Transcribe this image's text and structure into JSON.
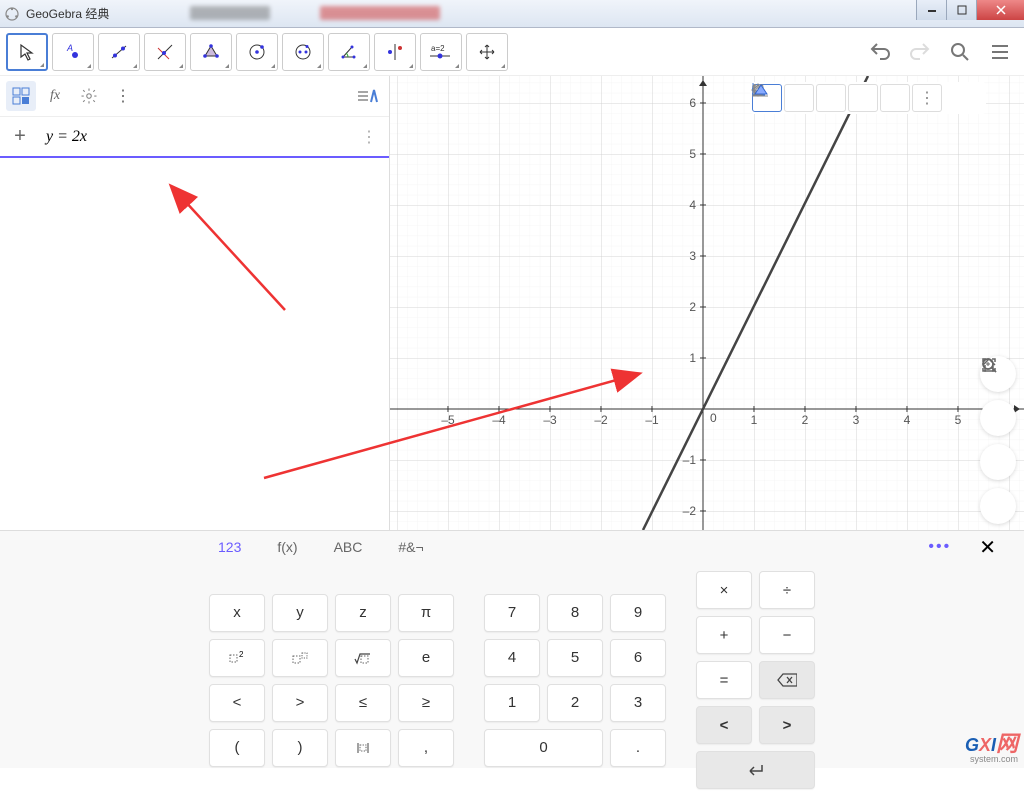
{
  "window": {
    "title": "GeoGebra 经典"
  },
  "toolbar": {
    "slider_label": "a=2"
  },
  "input": {
    "expression": "y  =  2x"
  },
  "chart_data": {
    "type": "line",
    "title": "",
    "xlabel": "",
    "ylabel": "",
    "xlim": [
      -5.5,
      6.2
    ],
    "ylim": [
      -2.2,
      6.3
    ],
    "xticks": [
      -5,
      -4,
      -3,
      -2,
      -1,
      0,
      1,
      2,
      3,
      4,
      5
    ],
    "yticks": [
      -2,
      -1,
      1,
      2,
      3,
      4,
      5,
      6
    ],
    "series": [
      {
        "name": "y = 2x",
        "equation": "y = 2*x",
        "points": [
          [
            -1.1,
            -2.2
          ],
          [
            3.15,
            6.3
          ]
        ]
      }
    ]
  },
  "keyboard": {
    "tabs": {
      "num": "123",
      "fx": "f(x)",
      "abc": "ABC",
      "sym": "#&¬"
    },
    "keys_g1_r1": [
      "x",
      "y",
      "z",
      "π"
    ],
    "keys_g1_r3": [
      "<",
      ">",
      "≤",
      "≥"
    ],
    "keys_g1_r4": [
      "(",
      ")",
      "",
      ","
    ],
    "keys_g2_r1": [
      "7",
      "8",
      "9"
    ],
    "keys_g2_r2": [
      "4",
      "5",
      "6"
    ],
    "keys_g2_r3": [
      "1",
      "2",
      "3"
    ],
    "keys_g2_r4": [
      "0",
      "."
    ],
    "keys_g3_r1": [
      "×",
      "÷"
    ],
    "keys_g3_r2": [
      "+",
      "−"
    ],
    "keys_g3_r3": [
      "="
    ],
    "keys_misc": {
      "e": "e",
      "sqrt": "√",
      "left": "<",
      "right": ">",
      "enter": "↵"
    }
  },
  "watermark": {
    "text": "GXI网",
    "sub": "system.com"
  }
}
